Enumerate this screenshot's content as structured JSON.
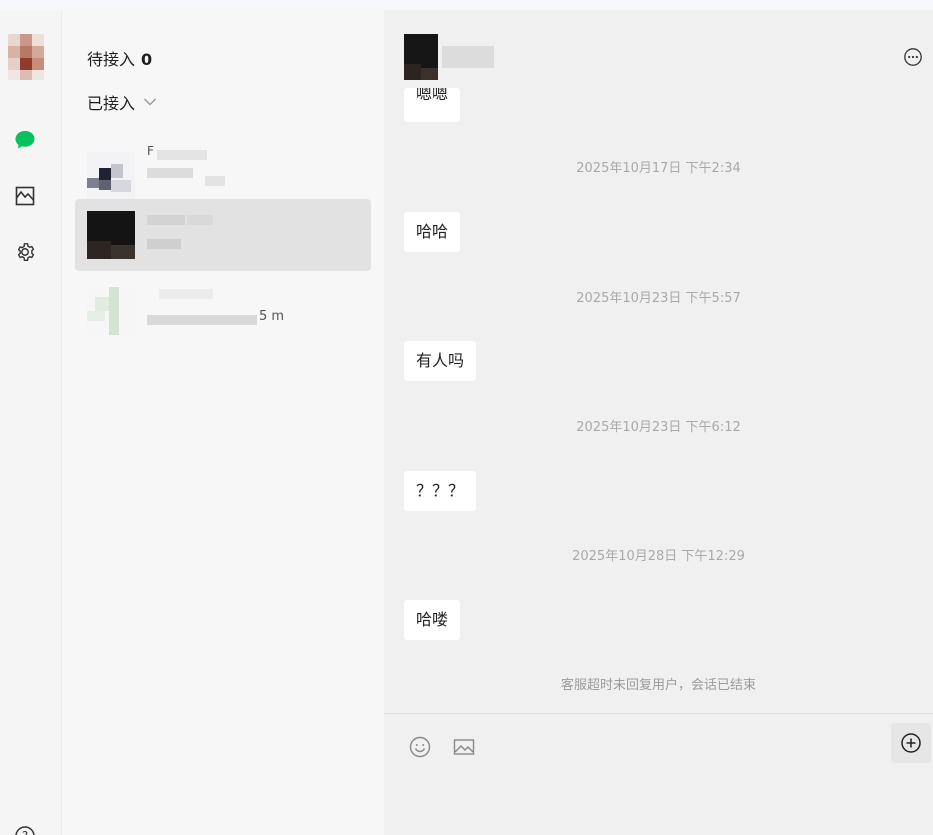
{
  "colors": {
    "accent_green": "#07c160",
    "timestamp_gray": "#a9a9a9",
    "bubble_bg": "#ffffff",
    "active_row": "#e2e2e2"
  },
  "rail": {
    "icons": [
      "chat-icon",
      "chart-icon",
      "gear-icon",
      "help-icon"
    ]
  },
  "list": {
    "pending_label": "待接入",
    "pending_count": "0",
    "accepted_label": "已接入",
    "sessions": [
      {
        "name": "F",
        "preview": ""
      },
      {
        "name": "",
        "preview": ""
      },
      {
        "name": "",
        "preview": "5 m"
      }
    ]
  },
  "chat": {
    "top_partial_message": "嗯嗯",
    "messages": [
      {
        "time": "2025年10月17日 下午2:34",
        "text": "哈哈"
      },
      {
        "time": "2025年10月23日 下午5:57",
        "text": "有人吗"
      },
      {
        "time": "2025年10月23日 下午6:12",
        "text": "？？？"
      },
      {
        "time": "2025年10月28日 下午12:29",
        "text": "哈喽"
      }
    ],
    "end_note": "客服超时未回复用户，会话已结束"
  }
}
